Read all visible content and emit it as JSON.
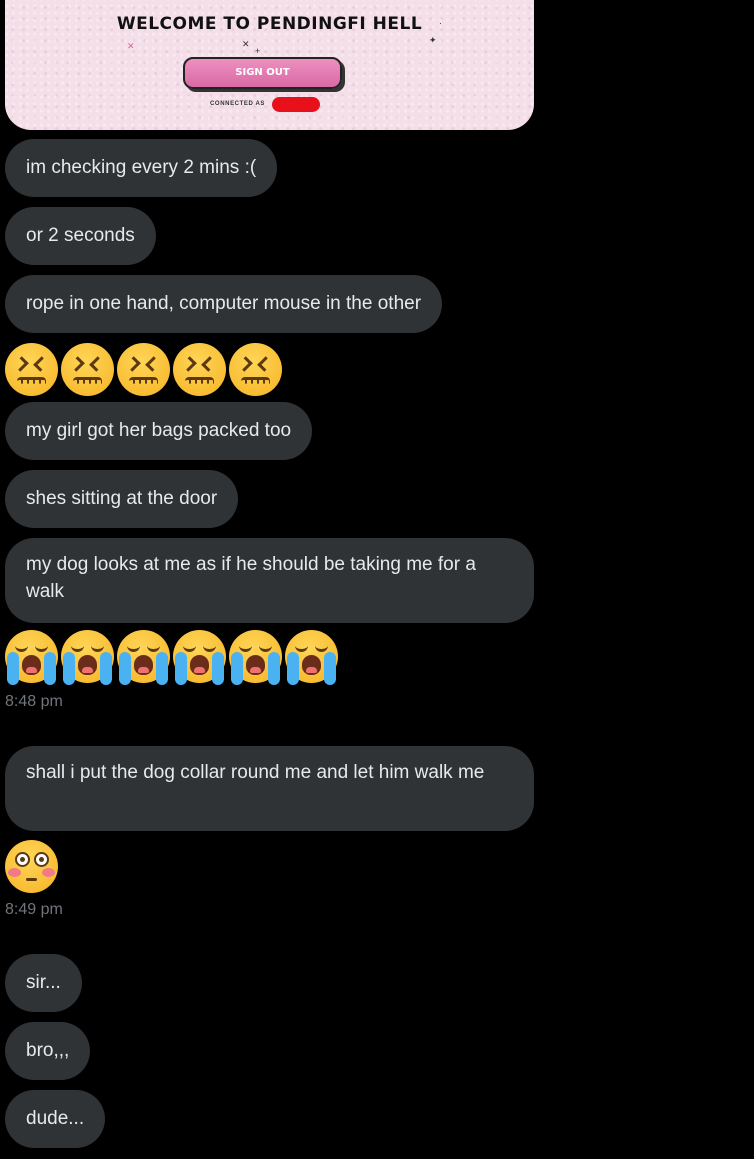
{
  "card": {
    "title": "WELCOME TO PENDINGFI HELL",
    "button_label": "SIGN OUT",
    "connected_label": "CONNECTED AS"
  },
  "messages": [
    "im checking every 2 mins :(",
    "or 2 seconds",
    "rope in one hand, computer mouse in the other",
    "my girl got her bags packed too",
    "shes sitting at the door",
    "my dog looks at me as if he should be taking me for a walk",
    "shall i put the dog collar round me and let him walk me",
    "sir...",
    "bro,,,",
    "dude..."
  ],
  "emoji_rows": [
    {
      "icon": "confounded-face-icon",
      "count": 5
    },
    {
      "icon": "loudly-crying-face-icon",
      "count": 6
    },
    {
      "icon": "flushed-face-icon",
      "count": 1
    }
  ],
  "timestamps": [
    "8:48 pm",
    "8:49 pm"
  ],
  "colors": {
    "background": "#000000",
    "bubble": "#2f3336",
    "text": "#e7e9ea",
    "timestamp": "#71767b",
    "card_bg": "#f4dfe9",
    "button": "#e07ab0",
    "redaction": "#e8101a"
  }
}
